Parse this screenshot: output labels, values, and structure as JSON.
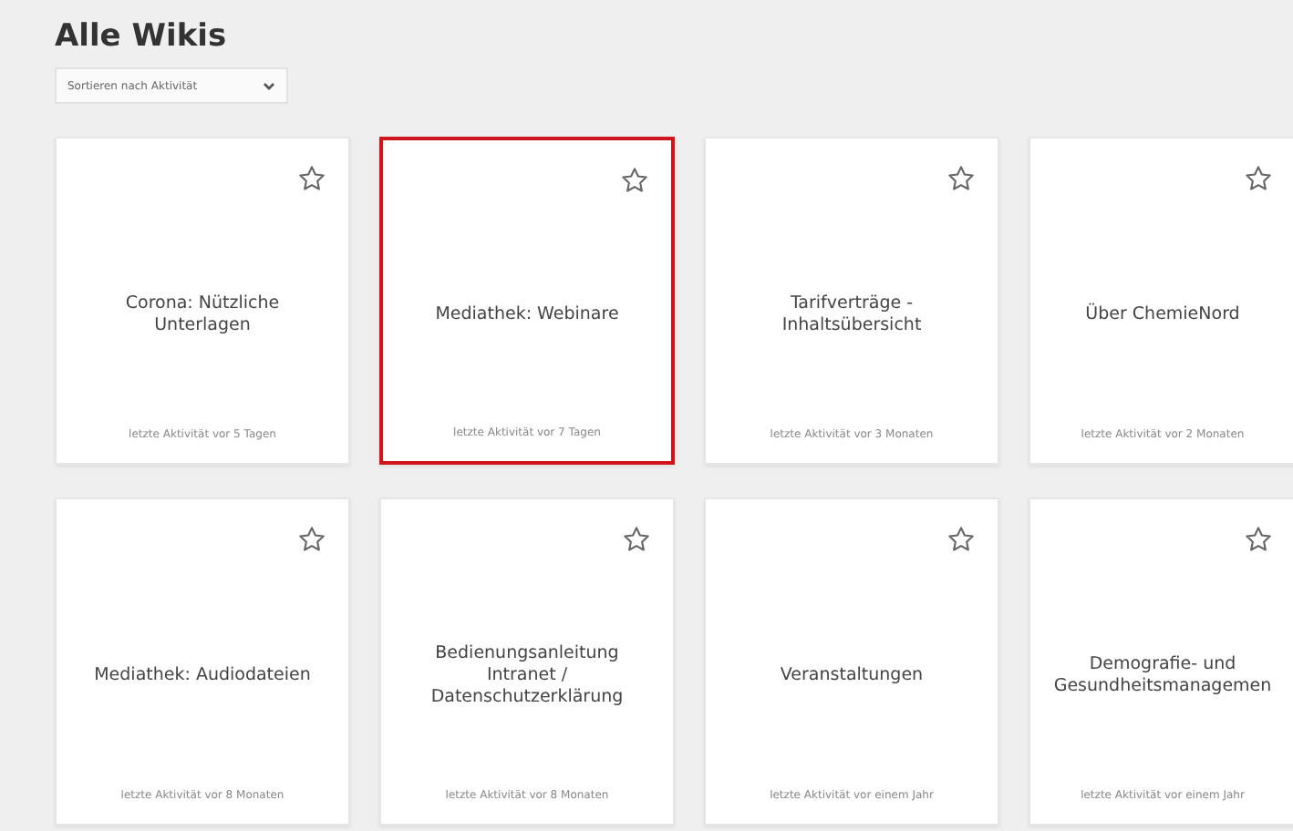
{
  "title": "Alle Wikis",
  "sort": {
    "value": "Sortieren nach Aktivität"
  },
  "wikis": [
    {
      "title": "Corona: Nützliche Unterlagen",
      "activity": "letzte Aktivität vor 5 Tagen",
      "selected": false,
      "favorite": false
    },
    {
      "title": "Mediathek: Webinare",
      "activity": "letzte Aktivität vor 7 Tagen",
      "selected": true,
      "favorite": false
    },
    {
      "title": "Tarifverträge - Inhaltsübersicht",
      "activity": "letzte Aktivität vor 3 Monaten",
      "selected": false,
      "favorite": false
    },
    {
      "title": "Über ChemieNord",
      "activity": "letzte Aktivität vor 2 Monaten",
      "selected": false,
      "favorite": false
    },
    {
      "title": "Mediathek: Audiodateien",
      "activity": "letzte Aktivität vor 8 Monaten",
      "selected": false,
      "favorite": false
    },
    {
      "title": "Bedienungsanleitung Intranet / Datenschutzerklärung",
      "activity": "letzte Aktivität vor 8 Monaten",
      "selected": false,
      "favorite": false
    },
    {
      "title": "Veranstaltungen",
      "activity": "letzte Aktivität vor einem Jahr",
      "selected": false,
      "favorite": false
    },
    {
      "title": "Demografie- und Gesundheitsmanagemen",
      "activity": "letzte Aktivität vor einem Jahr",
      "selected": false,
      "favorite": false
    }
  ]
}
